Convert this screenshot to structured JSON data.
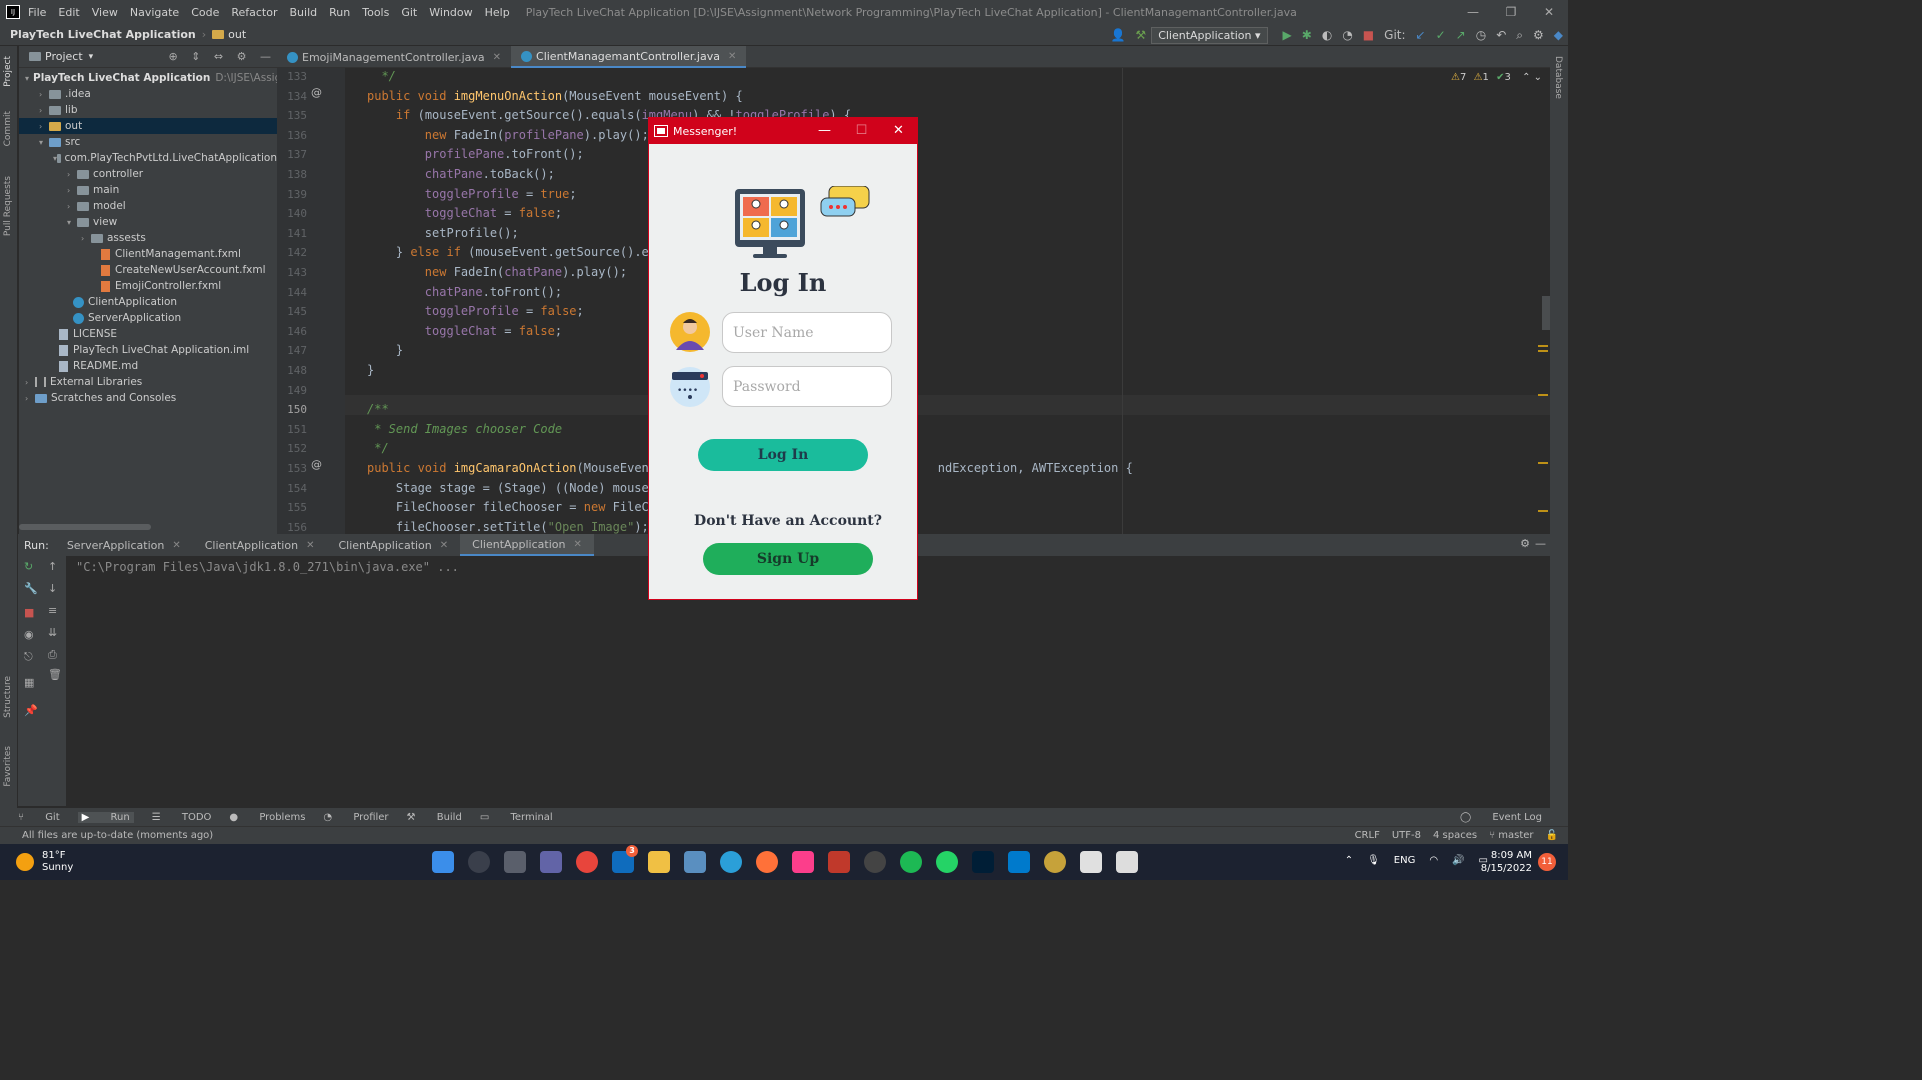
{
  "app": {
    "menu": [
      "File",
      "Edit",
      "View",
      "Navigate",
      "Code",
      "Refactor",
      "Build",
      "Run",
      "Tools",
      "Git",
      "Window",
      "Help"
    ],
    "window_title": "PlayTech LiveChat Application [D:\\IJSE\\Assignment\\Network Programming\\PlayTech LiveChat Application] - ClientManagemantController.java"
  },
  "navbar": {
    "project": "PlayTech LiveChat Application",
    "folder": "out",
    "run_config": "ClientApplication",
    "git_label": "Git:"
  },
  "left_strip": [
    "Project",
    "Commit",
    "Pull Requests",
    "Structure",
    "Favorites"
  ],
  "right_strip": [
    "Database"
  ],
  "project_panel": {
    "title": "Project",
    "rows": [
      {
        "label": "PlayTech LiveChat Application",
        "hint": "D:\\IJSE\\Assignment"
      },
      {
        "label": ".idea"
      },
      {
        "label": "lib"
      },
      {
        "label": "out"
      },
      {
        "label": "src"
      },
      {
        "label": "com.PlayTechPvtLtd.LiveChatApplication"
      },
      {
        "label": "controller"
      },
      {
        "label": "main"
      },
      {
        "label": "model"
      },
      {
        "label": "view"
      },
      {
        "label": "assests"
      },
      {
        "label": "ClientManagemant.fxml"
      },
      {
        "label": "CreateNewUserAccount.fxml"
      },
      {
        "label": "EmojiController.fxml"
      },
      {
        "label": "ClientApplication"
      },
      {
        "label": "ServerApplication"
      },
      {
        "label": "LICENSE"
      },
      {
        "label": "PlayTech LiveChat Application.iml"
      },
      {
        "label": "README.md"
      },
      {
        "label": "External Libraries"
      },
      {
        "label": "Scratches and Consoles"
      }
    ]
  },
  "editor_tabs": [
    "EmojiManagementController.java",
    "ClientManagemantController.java"
  ],
  "editor": {
    "warnings": {
      "warn": "7",
      "weak": "1",
      "ok": "3"
    },
    "line_numbers": [
      "133",
      "134",
      "135",
      "136",
      "137",
      "138",
      "139",
      "140",
      "141",
      "142",
      "143",
      "144",
      "145",
      "146",
      "147",
      "148",
      "149",
      "150",
      "151",
      "152",
      "153",
      "154",
      "155",
      "156"
    ]
  },
  "run_panel": {
    "label": "Run:",
    "tabs": [
      "ServerApplication",
      "ClientApplication",
      "ClientApplication",
      "ClientApplication"
    ],
    "console": "\"C:\\Program Files\\Java\\jdk1.8.0_271\\bin\\java.exe\" ..."
  },
  "tool_windows": [
    "Git",
    "Run",
    "TODO",
    "Problems",
    "Profiler",
    "Build",
    "Terminal"
  ],
  "event_log": "Event Log",
  "status": {
    "message": "All files are up-to-date (moments ago)",
    "line_sep": "CRLF",
    "encoding": "UTF-8",
    "indent": "4 spaces",
    "branch": "master"
  },
  "taskbar": {
    "temp": "81°F",
    "weather": "Sunny",
    "lang": "ENG",
    "time": "8:09 AM",
    "date": "8/15/2022",
    "notifications": "11",
    "mail_badge": "3"
  },
  "messenger": {
    "window_title": "Messenger!",
    "heading": "Log In",
    "username_placeholder": "User Name",
    "password_placeholder": "Password",
    "login_button": "Log In",
    "no_account": "Don't Have an Account?",
    "signup_button": "Sign Up",
    "colors": {
      "bar": "#d0021b",
      "login": "#1abc9c",
      "signup": "#1fae5b"
    }
  }
}
